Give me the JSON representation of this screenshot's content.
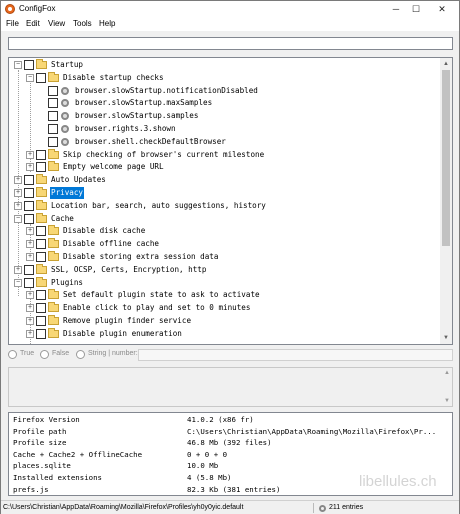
{
  "window": {
    "title": "ConfigFox",
    "minimize": "─",
    "maximize": "☐",
    "close": "✕"
  },
  "menu": [
    "File",
    "Edit",
    "View",
    "Tools",
    "Help"
  ],
  "search": {
    "value": ""
  },
  "tree": [
    {
      "label": "Startup",
      "level": 0,
      "kind": "folder",
      "expander": "−"
    },
    {
      "label": "Disable startup checks",
      "level": 1,
      "kind": "folder",
      "expander": "−"
    },
    {
      "label": "browser.slowStartup.notificationDisabled",
      "level": 2,
      "kind": "pref",
      "expander": ""
    },
    {
      "label": "browser.slowStartup.maxSamples",
      "level": 2,
      "kind": "pref",
      "expander": ""
    },
    {
      "label": "browser.slowStartup.samples",
      "level": 2,
      "kind": "pref",
      "expander": ""
    },
    {
      "label": "browser.rights.3.shown",
      "level": 2,
      "kind": "pref",
      "expander": ""
    },
    {
      "label": "browser.shell.checkDefaultBrowser",
      "level": 2,
      "kind": "pref",
      "expander": ""
    },
    {
      "label": "Skip checking of browser's current milestone",
      "level": 1,
      "kind": "folder",
      "expander": "+"
    },
    {
      "label": "Empty welcome page URL",
      "level": 1,
      "kind": "folder",
      "expander": "+"
    },
    {
      "label": "Auto Updates",
      "level": 0,
      "kind": "folder",
      "expander": "+"
    },
    {
      "label": "Privacy",
      "level": 0,
      "kind": "folder",
      "expander": "+",
      "selected": true
    },
    {
      "label": "Location bar, search, auto suggestions, history",
      "level": 0,
      "kind": "folder",
      "expander": "+"
    },
    {
      "label": "Cache",
      "level": 0,
      "kind": "folder",
      "expander": "−"
    },
    {
      "label": "Disable disk cache",
      "level": 1,
      "kind": "folder",
      "expander": "+"
    },
    {
      "label": "Disable offline cache",
      "level": 1,
      "kind": "folder",
      "expander": "+"
    },
    {
      "label": "Disable storing extra session data",
      "level": 1,
      "kind": "folder",
      "expander": "+"
    },
    {
      "label": "SSL, OCSP, Certs, Encryption, http",
      "level": 0,
      "kind": "folder",
      "expander": "+"
    },
    {
      "label": "Plugins",
      "level": 0,
      "kind": "folder",
      "expander": "−"
    },
    {
      "label": "Set default plugin state to ask to activate",
      "level": 1,
      "kind": "folder",
      "expander": "+"
    },
    {
      "label": "Enable click to play and set to 0 minutes",
      "level": 1,
      "kind": "folder",
      "expander": "+"
    },
    {
      "label": "Remove plugin finder service",
      "level": 1,
      "kind": "folder",
      "expander": "+"
    },
    {
      "label": "Disable plugin enumeration",
      "level": 1,
      "kind": "folder",
      "expander": "+"
    }
  ],
  "value_type": {
    "true_label": "True",
    "false_label": "False",
    "string_label": "String | number:"
  },
  "info": [
    {
      "key": "Firefox Version",
      "value": "41.0.2 (x86 fr)"
    },
    {
      "key": "Profile path",
      "value": "C:\\Users\\Christian\\AppData\\Roaming\\Mozilla\\Firefox\\Pr..."
    },
    {
      "key": "Profile size",
      "value": "46.8 Mb (392 files)"
    },
    {
      "key": "Cache + Cache2 + OfflineCache",
      "value": "0 + 0 + 0"
    },
    {
      "key": "places.sqlite",
      "value": "10.0 Mb"
    },
    {
      "key": "Installed extensions",
      "value": "4 (5.8 Mb)"
    },
    {
      "key": "prefs.js",
      "value": "82.3 Kb (381 entries)"
    }
  ],
  "watermark": "libellules.ch",
  "status": {
    "path": "C:\\Users\\Christian\\AppData\\Roaming\\Mozilla\\Firefox\\Profiles\\yh0y0yic.default",
    "entries": "211 entries"
  },
  "colors": {
    "selection": "#0078d7",
    "folder": "#f8d775"
  }
}
